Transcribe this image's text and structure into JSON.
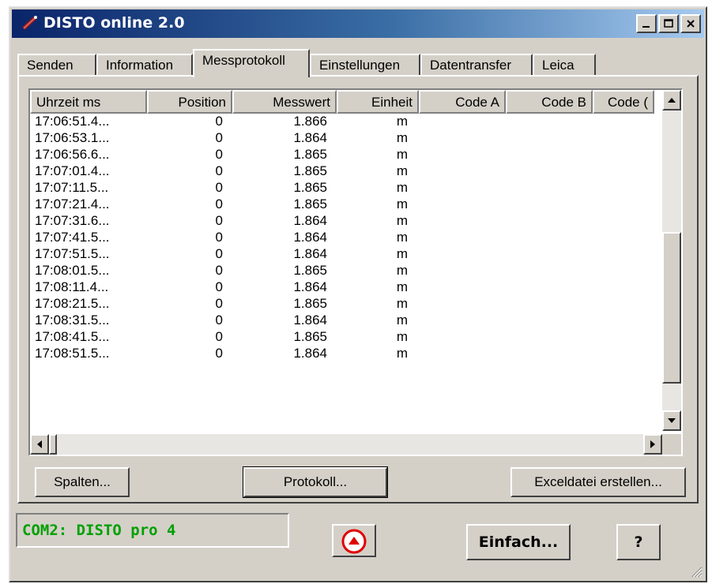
{
  "window": {
    "title": "DISTO online 2.0"
  },
  "tabs": [
    "Senden",
    "Information",
    "Messprotokoll",
    "Einstellungen",
    "Datentransfer",
    "Leica"
  ],
  "active_tab": "Messprotokoll",
  "table": {
    "columns": [
      "Uhrzeit ms",
      "Position",
      "Messwert",
      "Einheit",
      "Code A",
      "Code B",
      "Code ("
    ],
    "rows": [
      [
        "17:06:51.4...",
        "0",
        "1.866",
        "m"
      ],
      [
        "17:06:53.1...",
        "0",
        "1.864",
        "m"
      ],
      [
        "17:06:56.6...",
        "0",
        "1.865",
        "m"
      ],
      [
        "17:07:01.4...",
        "0",
        "1.865",
        "m"
      ],
      [
        "17:07:11.5...",
        "0",
        "1.865",
        "m"
      ],
      [
        "17:07:21.4...",
        "0",
        "1.865",
        "m"
      ],
      [
        "17:07:31.6...",
        "0",
        "1.864",
        "m"
      ],
      [
        "17:07:41.5...",
        "0",
        "1.864",
        "m"
      ],
      [
        "17:07:51.5...",
        "0",
        "1.864",
        "m"
      ],
      [
        "17:08:01.5...",
        "0",
        "1.865",
        "m"
      ],
      [
        "17:08:11.4...",
        "0",
        "1.864",
        "m"
      ],
      [
        "17:08:21.5...",
        "0",
        "1.865",
        "m"
      ],
      [
        "17:08:31.5...",
        "0",
        "1.864",
        "m"
      ],
      [
        "17:08:41.5...",
        "0",
        "1.865",
        "m"
      ],
      [
        "17:08:51.5...",
        "0",
        "1.864",
        "m"
      ]
    ]
  },
  "buttons": {
    "columns": "Spalten...",
    "protocol": "Protokoll...",
    "excel": "Exceldatei erstellen...",
    "simple": "Einfach...",
    "help": "?"
  },
  "status": {
    "text": "COM2: DISTO pro 4",
    "color": "#00a000"
  },
  "icons": {
    "app": "laser-pen-icon",
    "record": "red-circle-up-arrow-icon"
  },
  "vertical_scroll_position": 0.82
}
